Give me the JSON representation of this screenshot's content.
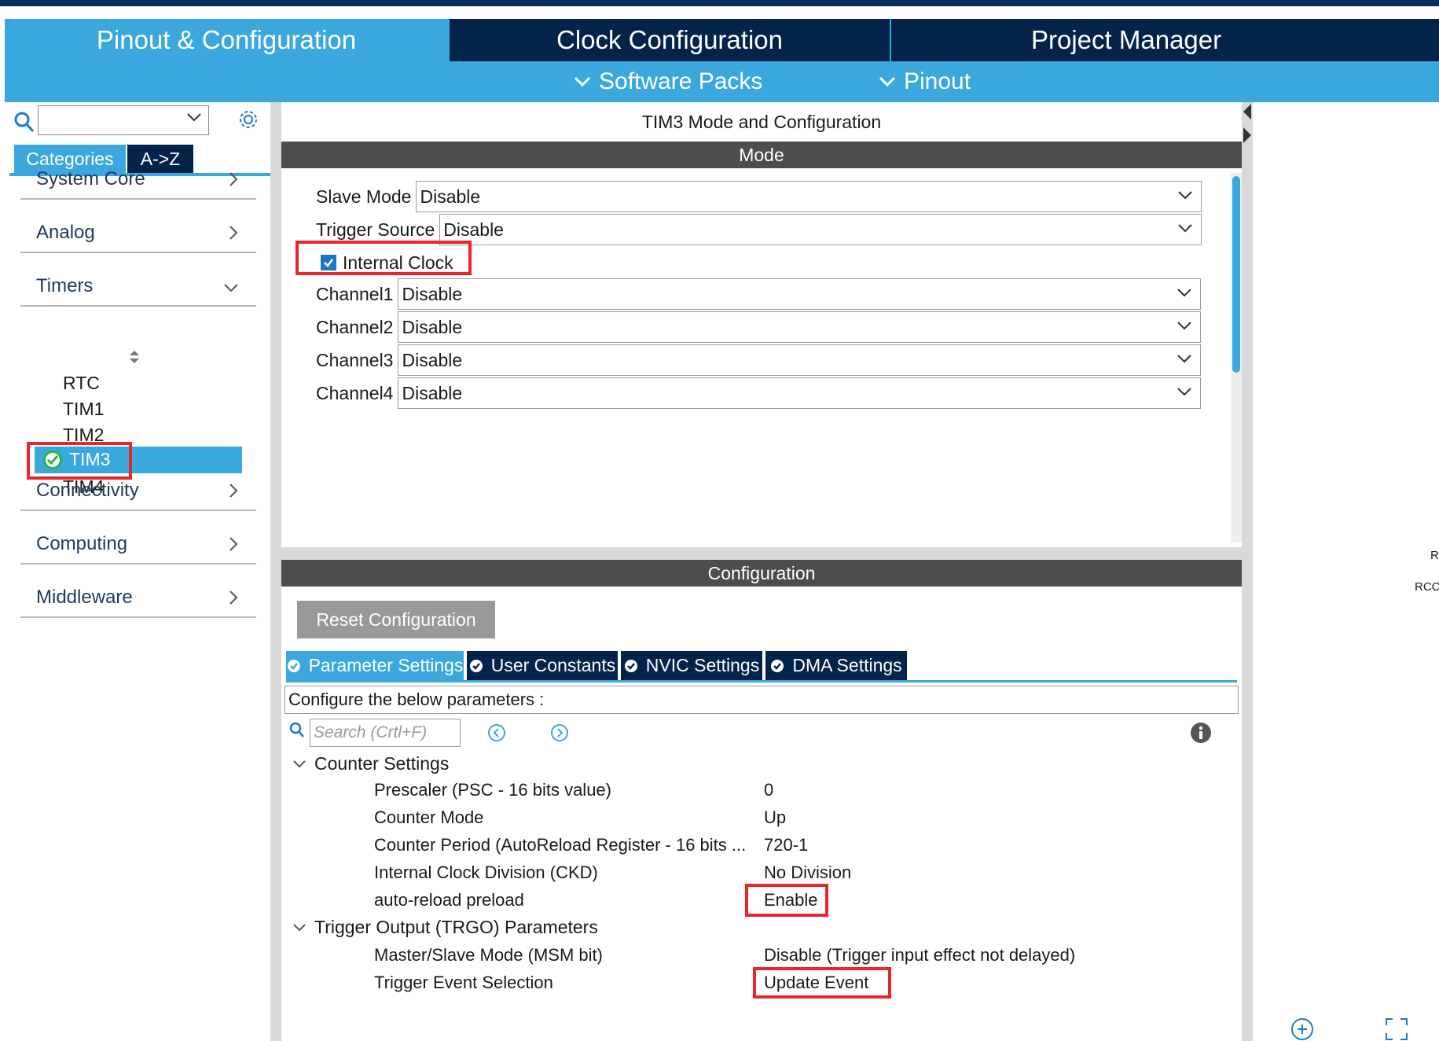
{
  "header": {
    "tabs": [
      {
        "label": "Pinout & Configuration",
        "active": true
      },
      {
        "label": "Clock Configuration",
        "active": false
      },
      {
        "label": "Project Manager",
        "active": false
      }
    ],
    "sub_menu": [
      {
        "label": "Software Packs"
      },
      {
        "label": "Pinout"
      }
    ]
  },
  "sidebar": {
    "category_tabs": [
      "Categories",
      "A->Z"
    ],
    "categories": [
      {
        "label": "System Core",
        "expanded": false
      },
      {
        "label": "Analog",
        "expanded": false
      },
      {
        "label": "Timers",
        "expanded": true
      },
      {
        "label": "Connectivity",
        "expanded": false
      },
      {
        "label": "Computing",
        "expanded": false
      },
      {
        "label": "Middleware",
        "expanded": false
      }
    ],
    "timers": [
      "RTC",
      "TIM1",
      "TIM2",
      "TIM3",
      "TIM4"
    ],
    "selected_timer": "TIM3"
  },
  "main": {
    "title": "TIM3 Mode and Configuration",
    "mode_header": "Mode",
    "mode": {
      "slave_mode": {
        "label": "Slave Mode",
        "value": "Disable"
      },
      "trigger_source": {
        "label": "Trigger Source",
        "value": "Disable"
      },
      "internal_clock": {
        "label": "Internal Clock",
        "checked": true
      },
      "channels": [
        {
          "label": "Channel1",
          "value": "Disable"
        },
        {
          "label": "Channel2",
          "value": "Disable"
        },
        {
          "label": "Channel3",
          "value": "Disable"
        },
        {
          "label": "Channel4",
          "value": "Disable"
        }
      ]
    },
    "config_header": "Configuration",
    "reset_button": "Reset Configuration",
    "param_tabs": [
      {
        "label": "Parameter Settings",
        "active": true
      },
      {
        "label": "User Constants",
        "active": false
      },
      {
        "label": "NVIC Settings",
        "active": false
      },
      {
        "label": "DMA Settings",
        "active": false
      }
    ],
    "configure_text": "Configure the below parameters :",
    "search_placeholder": "Search (Crtl+F)",
    "groups": [
      {
        "name": "Counter Settings",
        "params": [
          {
            "name": "Prescaler (PSC - 16 bits value)",
            "value": "0"
          },
          {
            "name": "Counter Mode",
            "value": "Up"
          },
          {
            "name": "Counter Period (AutoReload Register - 16 bits ...",
            "value": "720-1"
          },
          {
            "name": "Internal Clock Division (CKD)",
            "value": "No Division"
          },
          {
            "name": "auto-reload preload",
            "value": "Enable"
          }
        ]
      },
      {
        "name": "Trigger Output (TRGO) Parameters",
        "params": [
          {
            "name": "Master/Slave Mode (MSM bit)",
            "value": "Disable (Trigger input effect not delayed)"
          },
          {
            "name": "Trigger Event Selection",
            "value": "Update Event"
          }
        ]
      }
    ]
  },
  "right_panel": {
    "labels": [
      "R",
      "RCC"
    ]
  },
  "colors": {
    "accent": "#3aa8dc",
    "navy": "#03234b",
    "header_gray": "#4d4d4d",
    "highlight_red": "#e8262c",
    "check_green": "#2eb34a"
  }
}
